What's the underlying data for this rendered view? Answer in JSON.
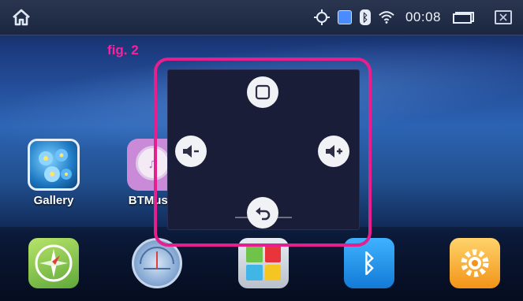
{
  "status_bar": {
    "time": "00:08",
    "icons": [
      "home-icon",
      "gps-icon",
      "image-notification-icon",
      "bluetooth-icon",
      "wifi-icon",
      "recent-apps-icon",
      "close-window-icon"
    ]
  },
  "annotation": {
    "label": "fig. 2",
    "color": "#e71f8e"
  },
  "desktop_apps": [
    {
      "label": "Gallery",
      "icon": "gallery-icon"
    },
    {
      "label": "BTMusic",
      "icon": "bt-music-icon"
    }
  ],
  "volume_panel": {
    "controls": [
      "square-button-icon",
      "volume-down-icon",
      "volume-up-icon",
      "back-arrow-icon"
    ]
  },
  "dock": {
    "items": [
      "navigation-icon",
      "radio-icon",
      "apps-grid-icon",
      "bluetooth-icon",
      "settings-icon"
    ]
  },
  "colors": {
    "accent": "#e71f8e",
    "status_bar_bg": "#1b2740",
    "panel_bg": "#1a1d38"
  }
}
